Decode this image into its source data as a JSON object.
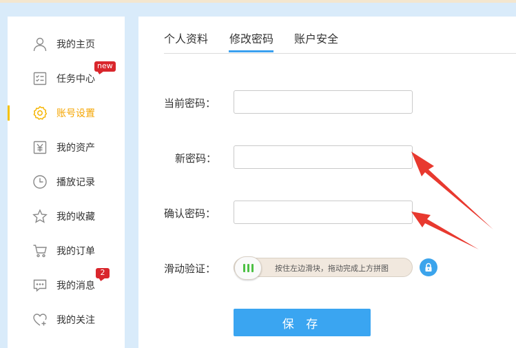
{
  "sidebar": {
    "items": [
      {
        "label": "我的主页",
        "icon": "user-icon"
      },
      {
        "label": "任务中心",
        "icon": "task-list-icon",
        "badge": "new"
      },
      {
        "label": "账号设置",
        "icon": "gear-icon",
        "active": true
      },
      {
        "label": "我的资产",
        "icon": "yuan-icon"
      },
      {
        "label": "播放记录",
        "icon": "clock-icon"
      },
      {
        "label": "我的收藏",
        "icon": "star-icon"
      },
      {
        "label": "我的订单",
        "icon": "cart-icon"
      },
      {
        "label": "我的消息",
        "icon": "message-icon",
        "badge": "2"
      },
      {
        "label": "我的关注",
        "icon": "heart-plus-icon"
      }
    ]
  },
  "tabs": [
    {
      "label": "个人资料"
    },
    {
      "label": "修改密码",
      "active": true
    },
    {
      "label": "账户安全"
    }
  ],
  "form": {
    "current_password_label": "当前密码：",
    "new_password_label": "新密码：",
    "confirm_password_label": "确认密码：",
    "slider_label": "滑动验证：",
    "slider_text": "按住左边滑块，拖动完成上方拼图",
    "save_label": "保 存"
  },
  "colors": {
    "accent": "#3aa5f1",
    "active_nav": "#f5a500",
    "badge": "#d9262c",
    "annotation_arrow": "#e8392f"
  }
}
